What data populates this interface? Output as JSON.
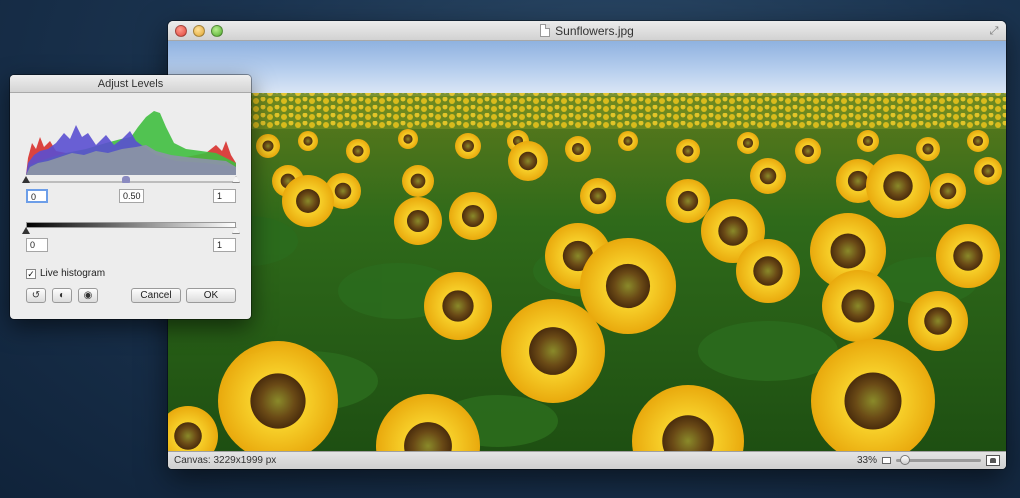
{
  "window": {
    "title": "Sunflowers.jpg",
    "status_canvas": "Canvas: 3229x1999 px",
    "zoom": "33%",
    "zoom_level": 0.05
  },
  "levels_panel": {
    "title": "Adjust Levels",
    "input_black": "0",
    "input_gamma": "0.50",
    "input_white": "1",
    "output_black": "0",
    "output_white": "1",
    "live_histogram_label": "Live histogram",
    "live_histogram_checked": true,
    "cancel_label": "Cancel",
    "ok_label": "OK",
    "icons": [
      "reset-icon",
      "contrast-icon",
      "preview-eye-icon"
    ]
  },
  "colors": {
    "accent_focus": "#6d9ee8",
    "histogram_red": "#d7302c",
    "histogram_green": "#3fbe3f",
    "histogram_blue": "#5a4fd0",
    "histogram_grey": "#8a93a5"
  }
}
